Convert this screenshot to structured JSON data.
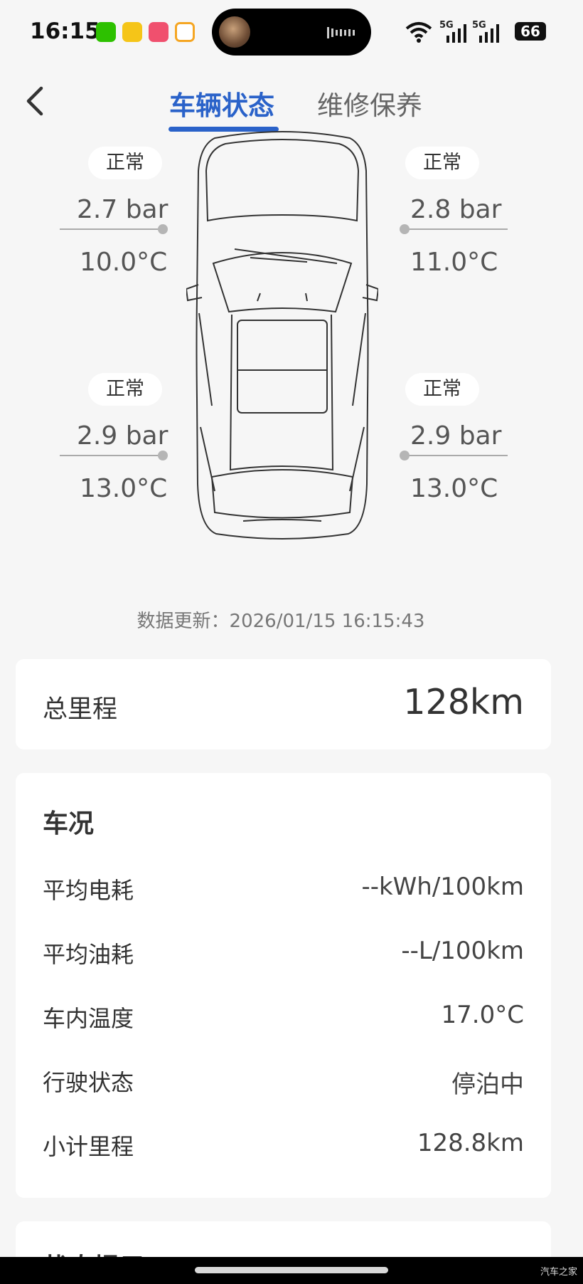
{
  "status_bar": {
    "time": "16:15",
    "battery": "66",
    "network_1": "5G",
    "network_2": "5G",
    "app_icons": [
      "wechat-icon",
      "app-a-icon",
      "shopping-app-icon",
      "video-app-icon"
    ]
  },
  "header": {
    "tabs": [
      {
        "label": "车辆状态",
        "active": true
      },
      {
        "label": "维修保养",
        "active": false
      }
    ]
  },
  "tires": {
    "front_left": {
      "status": "正常",
      "pressure": "2.7 bar",
      "temperature": "10.0°C"
    },
    "front_right": {
      "status": "正常",
      "pressure": "2.8 bar",
      "temperature": "11.0°C"
    },
    "rear_left": {
      "status": "正常",
      "pressure": "2.9 bar",
      "temperature": "13.0°C"
    },
    "rear_right": {
      "status": "正常",
      "pressure": "2.9 bar",
      "temperature": "13.0°C"
    }
  },
  "update": {
    "text": "数据更新：2026/01/15 16:15:43"
  },
  "mileage": {
    "label": "总里程",
    "value": "128km"
  },
  "condition": {
    "title": "车况",
    "rows": [
      {
        "label": "平均电耗",
        "value": "--kWh/100km"
      },
      {
        "label": "平均油耗",
        "value": "--L/100km"
      },
      {
        "label": "车内温度",
        "value": "17.0°C"
      },
      {
        "label": "行驶状态",
        "value": "停泊中"
      },
      {
        "label": "小计里程",
        "value": "128.8km"
      }
    ]
  },
  "next_card": {
    "title_partial": "状态提示"
  },
  "watermark": "汽车之家",
  "colors": {
    "accent": "#2a62c9",
    "background": "#f6f6f6",
    "card": "#ffffff"
  }
}
